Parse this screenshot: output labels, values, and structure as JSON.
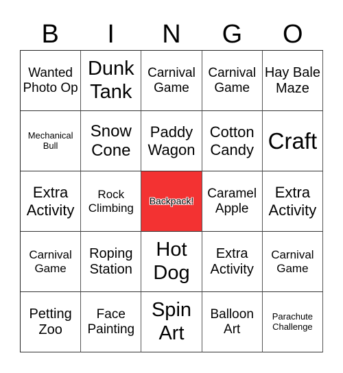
{
  "header": {
    "letters": [
      "B",
      "I",
      "N",
      "G",
      "O"
    ]
  },
  "colors": {
    "free_cell": "#F33232",
    "border": "#333333"
  },
  "cells": [
    {
      "text": "Wanted Photo Op",
      "size": "s19"
    },
    {
      "text": "Dunk Tank",
      "size": "s29"
    },
    {
      "text": "Carnival Game",
      "size": "s19"
    },
    {
      "text": "Carnival Game",
      "size": "s19"
    },
    {
      "text": "Hay Bale Maze",
      "size": "s20"
    },
    {
      "text": "Mechanical Bull",
      "size": "s13"
    },
    {
      "text": "Snow Cone",
      "size": "s24"
    },
    {
      "text": "Paddy Wagon",
      "size": "s22"
    },
    {
      "text": "Cotton Candy",
      "size": "s22"
    },
    {
      "text": "Craft",
      "size": "s33"
    },
    {
      "text": "Extra Activity",
      "size": "s22"
    },
    {
      "text": "Rock Climbing",
      "size": "s17"
    },
    {
      "text": "Backpack!",
      "size": "free"
    },
    {
      "text": "Caramel Apple",
      "size": "s19"
    },
    {
      "text": "Extra Activity",
      "size": "s22"
    },
    {
      "text": "Carnival Game",
      "size": "s17"
    },
    {
      "text": "Roping Station",
      "size": "s20"
    },
    {
      "text": "Hot Dog",
      "size": "s29"
    },
    {
      "text": "Extra Activity",
      "size": "s20"
    },
    {
      "text": "Carnival Game",
      "size": "s17"
    },
    {
      "text": "Petting Zoo",
      "size": "s20"
    },
    {
      "text": "Face Painting",
      "size": "s19"
    },
    {
      "text": "Spin Art",
      "size": "s29"
    },
    {
      "text": "Balloon Art",
      "size": "s19"
    },
    {
      "text": "Parachute Challenge",
      "size": "s13"
    }
  ]
}
